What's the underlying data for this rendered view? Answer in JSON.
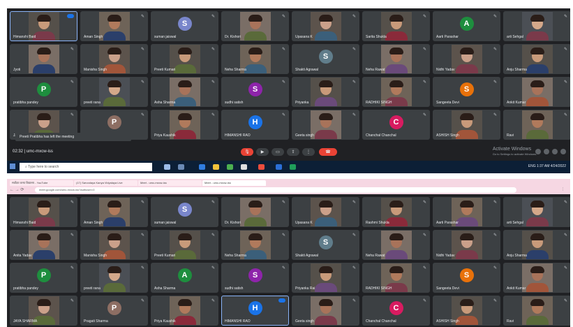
{
  "colors": {
    "meet_bg": "#202124",
    "tile_bg": "#3c4043",
    "active_border": "#8ab4f8",
    "end_call": "#ea4335",
    "taskbar": "#0c1f36",
    "browser_bar": "#f6d7e3"
  },
  "shot1": {
    "tiles": [
      {
        "name": "Himanshi Baid",
        "kind": "photo",
        "active": true,
        "badge": true
      },
      {
        "name": "Aman Singh",
        "kind": "photo"
      },
      {
        "name": "suman jaiswal",
        "kind": "avatar",
        "letter": "S",
        "color": "#7986cb"
      },
      {
        "name": "Dr. Kishori",
        "kind": "photo"
      },
      {
        "name": "Upasana K",
        "kind": "photo"
      },
      {
        "name": "Sarita Shukla",
        "kind": "photo"
      },
      {
        "name": "Aarti Parashar",
        "kind": "avatar",
        "letter": "A",
        "color": "#1e8e3e"
      },
      {
        "name": "arti Sehgal",
        "kind": "photo"
      },
      {
        "name": "Jyoti",
        "kind": "photo"
      },
      {
        "name": "Manisha Singh",
        "kind": "photo"
      },
      {
        "name": "Preeti Kumari",
        "kind": "photo"
      },
      {
        "name": "Neha Sharma",
        "kind": "photo"
      },
      {
        "name": "Shakti Agrawal",
        "kind": "avatar",
        "letter": "S",
        "color": "#607d8b"
      },
      {
        "name": "Neha Rawat",
        "kind": "photo"
      },
      {
        "name": "Nidhi Yadav",
        "kind": "photo"
      },
      {
        "name": "Anju Sharma",
        "kind": "photo"
      },
      {
        "name": "pratibha pandey",
        "kind": "avatar",
        "letter": "P",
        "color": "#1e8e3e"
      },
      {
        "name": "preeti rana",
        "kind": "photo"
      },
      {
        "name": "Asha Sharma",
        "kind": "photo"
      },
      {
        "name": "sudhi satish",
        "kind": "avatar",
        "letter": "S",
        "color": "#8e24aa"
      },
      {
        "name": "Priyanka",
        "kind": "photo"
      },
      {
        "name": "RADHIKI SINGH",
        "kind": "photo"
      },
      {
        "name": "Sangeeta Devi",
        "kind": "avatar",
        "letter": "S",
        "color": "#e8710a"
      },
      {
        "name": "Ankit Kumar",
        "kind": "photo"
      },
      {
        "name": "JAYA SHARMA",
        "kind": "photo"
      },
      {
        "name": "Pragati Sharma",
        "kind": "avatar",
        "letter": "P",
        "color": "#8d6e63"
      },
      {
        "name": "Priya Kaushik",
        "kind": "photo"
      },
      {
        "name": "HIMANSHI RAO",
        "kind": "avatar",
        "letter": "H",
        "color": "#1a73e8"
      },
      {
        "name": "Geeta singh",
        "kind": "photo"
      },
      {
        "name": "Chanchal Chanchal",
        "kind": "avatar",
        "letter": "C",
        "color": "#d81b60"
      },
      {
        "name": "ASHISH Singh",
        "kind": "photo"
      },
      {
        "name": "Ravi",
        "kind": "photo"
      }
    ],
    "toast": "Preeti Pratibha has left the meeting",
    "time": "02:32",
    "meeting_code": "umc-mxcw-iss",
    "activate_line1": "Activate Windows",
    "activate_line2": "Go to Settings to activate Windows.",
    "search_placeholder": "Type here to search",
    "tray_text": "ENG 1:37 AM 4/24/2022"
  },
  "shot2": {
    "tabs": [
      "सर्वोदय कन्या विद्यालय - YouTube",
      "(17) Sarvodaya Kanya Vidyalaya Live",
      "Meet - umc-mxcw-iss",
      "Meet - umc-mxcw-iss"
    ],
    "url": "meet.google.com/umc-mxcw-iss?authuser=0",
    "tiles": [
      {
        "name": "Himanshi Baid",
        "kind": "photo"
      },
      {
        "name": "Aman Singh",
        "kind": "photo"
      },
      {
        "name": "suman jaiswal",
        "kind": "avatar",
        "letter": "S",
        "color": "#7986cb"
      },
      {
        "name": "Dr. Kishori",
        "kind": "photo"
      },
      {
        "name": "Upasana K",
        "kind": "photo"
      },
      {
        "name": "Rashmi Shukla",
        "kind": "photo"
      },
      {
        "name": "Aarti Parashar",
        "kind": "photo"
      },
      {
        "name": "arti Sehgal",
        "kind": "photo"
      },
      {
        "name": "Anita Yadav",
        "kind": "photo"
      },
      {
        "name": "Manisha Singh",
        "kind": "photo"
      },
      {
        "name": "Preeti Kumari",
        "kind": "photo"
      },
      {
        "name": "Neha Sharma",
        "kind": "photo"
      },
      {
        "name": "Shakti Agrawal",
        "kind": "avatar",
        "letter": "S",
        "color": "#607d8b"
      },
      {
        "name": "Neha Rawat",
        "kind": "photo"
      },
      {
        "name": "Nidhi Yadav",
        "kind": "photo"
      },
      {
        "name": "Anju Sharma",
        "kind": "photo"
      },
      {
        "name": "pratibha pandey",
        "kind": "avatar",
        "letter": "P",
        "color": "#1e8e3e"
      },
      {
        "name": "preeti rana",
        "kind": "photo"
      },
      {
        "name": "Asha Sharma",
        "kind": "avatar",
        "letter": "A",
        "color": "#1e8e3e"
      },
      {
        "name": "sudhi satish",
        "kind": "avatar",
        "letter": "S",
        "color": "#8e24aa"
      },
      {
        "name": "Priyanka Rai",
        "kind": "photo"
      },
      {
        "name": "RADHIKI SINGH",
        "kind": "photo"
      },
      {
        "name": "Sangeeta Devi",
        "kind": "avatar",
        "letter": "S",
        "color": "#e8710a"
      },
      {
        "name": "Ankit Kumar",
        "kind": "photo"
      },
      {
        "name": "JAYA SHARMA",
        "kind": "photo"
      },
      {
        "name": "Pragati Sharma",
        "kind": "avatar",
        "letter": "P",
        "color": "#8d6e63"
      },
      {
        "name": "Priya Kaushik",
        "kind": "photo"
      },
      {
        "name": "HIMANSHI RAO",
        "kind": "avatar",
        "letter": "H",
        "color": "#1a73e8",
        "active": true,
        "badge": true
      },
      {
        "name": "Geeta singh",
        "kind": "photo"
      },
      {
        "name": "Chanchal Chanchal",
        "kind": "avatar",
        "letter": "C",
        "color": "#d81b60"
      },
      {
        "name": "ASHISH Singh",
        "kind": "photo"
      },
      {
        "name": "Ravi",
        "kind": "photo"
      }
    ]
  }
}
